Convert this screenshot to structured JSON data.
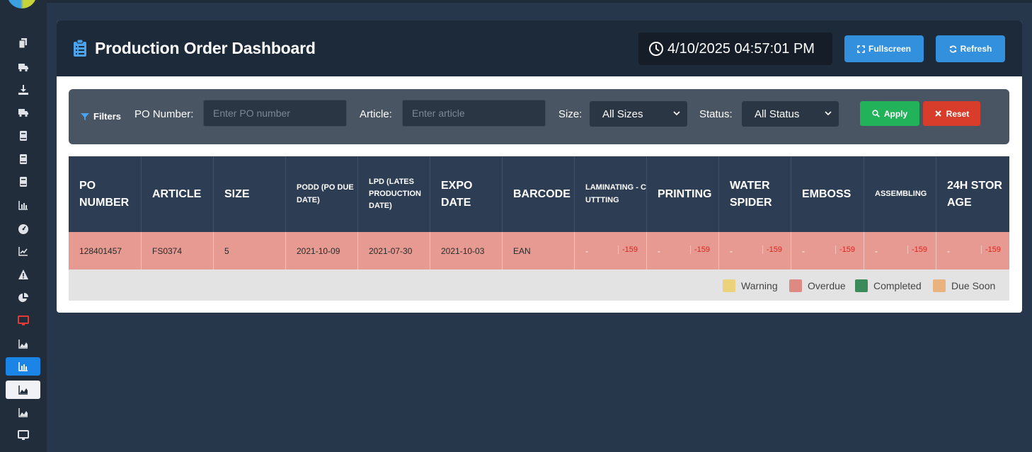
{
  "header": {
    "title": "Production Order Dashboard",
    "datetime": "4/10/2025 04:57:01 PM",
    "fullscreen_label": "Fullscreen",
    "refresh_label": "Refresh"
  },
  "filters": {
    "tag": "Filters",
    "po_label": "PO Number:",
    "po_placeholder": "Enter PO number",
    "article_label": "Article:",
    "article_placeholder": "Enter article",
    "size_label": "Size:",
    "size_value": "All Sizes",
    "status_label": "Status:",
    "status_value": "All Status",
    "apply_label": "Apply",
    "reset_label": "Reset"
  },
  "table": {
    "columns": [
      "PO NUMBER",
      "ARTICLE",
      "SIZE",
      "PODD (PO DUE DATE)",
      "LPD (LATES PRODUCTION DATE)",
      "EXPO DATE",
      "BARCODE",
      "LAMINATING - CUTTTING",
      "PRINTING",
      "WATER SPIDER",
      "EMBOSS",
      "ASSEMBLING",
      "24H STORAGE"
    ],
    "rows": [
      {
        "po_number": "128401457",
        "article": "FS0374",
        "size": "5",
        "podd": "2021-10-09",
        "lpd": "2021-07-30",
        "expo": "2021-10-03",
        "barcode": "EAN",
        "stages": [
          {
            "dash": "-",
            "value": "-159"
          },
          {
            "dash": "-",
            "value": "-159"
          },
          {
            "dash": "-",
            "value": "-159"
          },
          {
            "dash": "-",
            "value": "-159"
          },
          {
            "dash": "-",
            "value": "-159"
          },
          {
            "dash": "-",
            "value": "-159"
          }
        ]
      }
    ]
  },
  "legend": [
    {
      "label": "Warning",
      "color": "#ecd27a"
    },
    {
      "label": "Overdue",
      "color": "#dc8a82"
    },
    {
      "label": "Completed",
      "color": "#3a8a5a"
    },
    {
      "label": "Due Soon",
      "color": "#eab27e"
    }
  ],
  "colors": {
    "accent": "#1b84e7",
    "overdue_row": "#e69a91",
    "apply": "#22b25a",
    "reset": "#d83d2c"
  },
  "sidebar": {
    "icons": [
      "copy-icon",
      "truck-icon",
      "download-icon",
      "truck-icon",
      "book-icon",
      "book-icon",
      "book-icon",
      "bar-chart-icon",
      "gauge-icon",
      "line-chart-icon",
      "warning-icon",
      "pie-chart-icon",
      "monitor-icon",
      "area-chart-icon",
      "bar-chart-icon",
      "area-chart-icon",
      "area-chart-icon",
      "monitor-icon"
    ]
  }
}
